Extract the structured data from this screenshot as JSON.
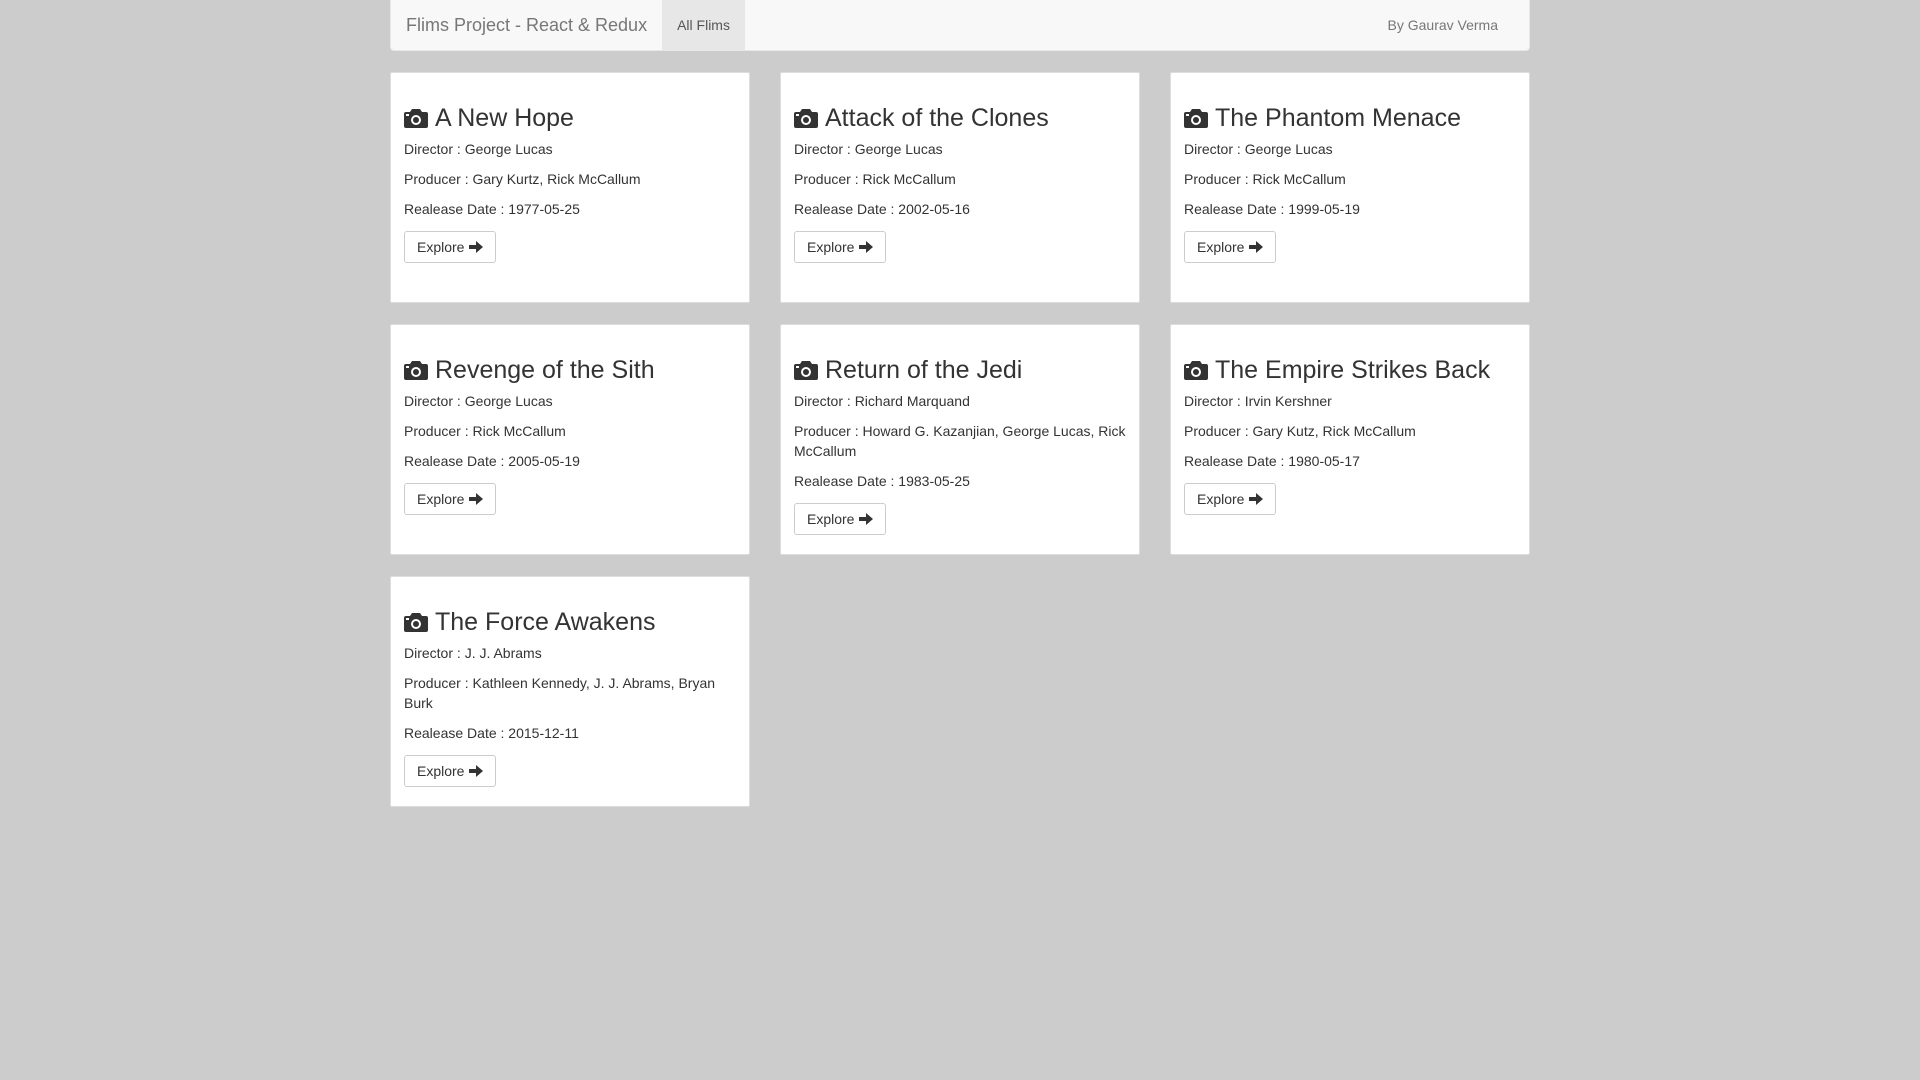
{
  "navbar": {
    "brand": "Flims Project - React & Redux",
    "active_tab": "All Flims",
    "author": "By Gaurav Verma"
  },
  "labels": {
    "director": "Director : ",
    "producer": "Producer : ",
    "release": "Realease Date : ",
    "explore": "Explore"
  },
  "films": [
    {
      "title": "A New Hope",
      "director": "George Lucas",
      "producer": "Gary Kurtz, Rick McCallum",
      "release_date": "1977-05-25"
    },
    {
      "title": "Attack of the Clones",
      "director": "George Lucas",
      "producer": "Rick McCallum",
      "release_date": "2002-05-16"
    },
    {
      "title": "The Phantom Menace",
      "director": "George Lucas",
      "producer": "Rick McCallum",
      "release_date": "1999-05-19"
    },
    {
      "title": "Revenge of the Sith",
      "director": "George Lucas",
      "producer": "Rick McCallum",
      "release_date": "2005-05-19"
    },
    {
      "title": "Return of the Jedi",
      "director": "Richard Marquand",
      "producer": "Howard G. Kazanjian, George Lucas, Rick McCallum",
      "release_date": "1983-05-25"
    },
    {
      "title": "The Empire Strikes Back",
      "director": "Irvin Kershner",
      "producer": "Gary Kutz, Rick McCallum",
      "release_date": "1980-05-17"
    },
    {
      "title": "The Force Awakens",
      "director": "J. J. Abrams",
      "producer": "Kathleen Kennedy, J. J. Abrams, Bryan Burk",
      "release_date": "2015-12-11"
    }
  ]
}
